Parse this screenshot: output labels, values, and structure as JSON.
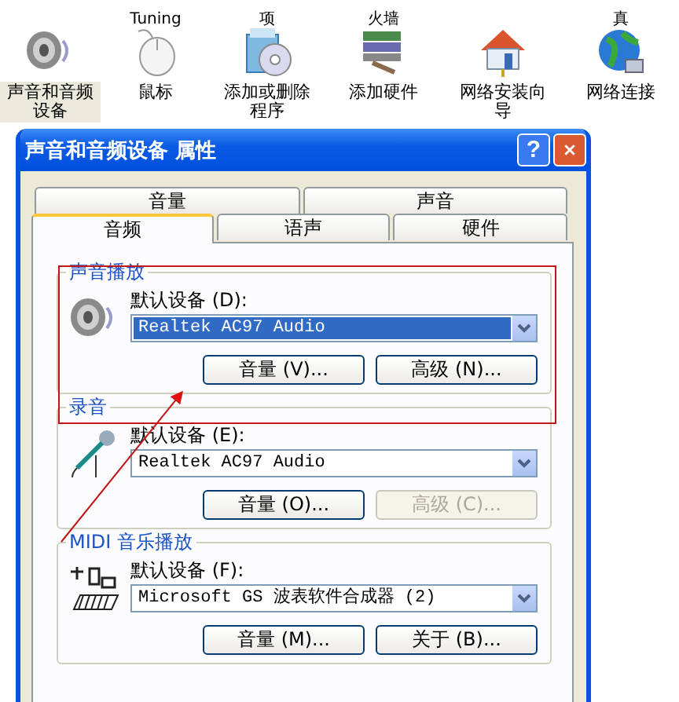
{
  "control_panel_items": [
    {
      "label": "声音和音频设备",
      "kind": "speaker",
      "selected": true
    },
    {
      "label_above": "Tuning",
      "label": "鼠标",
      "kind": "mouse",
      "selected": false
    },
    {
      "label_above": "项",
      "label": "添加或删除程序",
      "kind": "installer",
      "selected": false
    },
    {
      "label_above": "火墙",
      "label": "添加硬件",
      "kind": "hardware",
      "selected": false
    },
    {
      "label": "网络安装向导",
      "kind": "house",
      "selected": false
    },
    {
      "label_above": "真",
      "label": "网络连接",
      "kind": "globe",
      "selected": false
    }
  ],
  "window": {
    "title": "声音和音频设备 属性",
    "help_button": "?"
  },
  "tab_rows": [
    [
      {
        "label": "音量",
        "selected": false
      },
      {
        "label": "声音",
        "selected": false
      }
    ],
    [
      {
        "label": "音频",
        "selected": true
      },
      {
        "label": "语声",
        "selected": false
      },
      {
        "label": "硬件",
        "selected": false
      }
    ]
  ],
  "groups": [
    {
      "title": "声音播放",
      "kind": "speaker",
      "field_label": "默认设备 (D):",
      "value": "Realtek AC97 Audio",
      "focused": true,
      "buttons": [
        {
          "label": "音量 (V)...",
          "disabled": false
        },
        {
          "label": "高级 (N)...",
          "disabled": false
        }
      ]
    },
    {
      "title": "录音",
      "kind": "microphone",
      "field_label": "默认设备 (E):",
      "value": "Realtek AC97 Audio",
      "focused": false,
      "buttons": [
        {
          "label": "音量 (O)...",
          "disabled": false
        },
        {
          "label": "高级 (C)...",
          "disabled": true
        }
      ]
    },
    {
      "title": "MIDI 音乐播放",
      "kind": "midi",
      "field_label": "默认设备 (F):",
      "value": "Microsoft GS 波表软件合成器 (2)",
      "focused": false,
      "buttons": [
        {
          "label": "音量 (M)...",
          "disabled": false
        },
        {
          "label": "关于 (B)...",
          "disabled": false
        }
      ]
    }
  ]
}
